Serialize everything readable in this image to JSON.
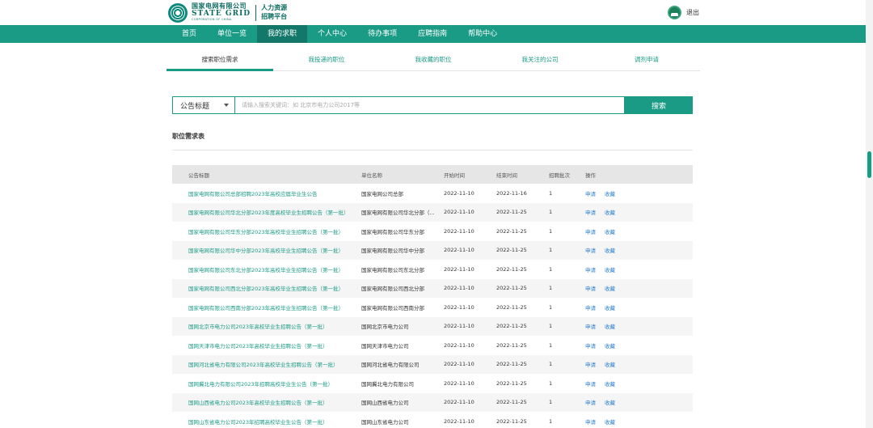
{
  "header": {
    "logo_cn": "国家电网有限公司",
    "logo_en": "STATE GRID",
    "logo_en_sub": "CORPORATION OF CHINA",
    "platform_line1": "人力资源",
    "platform_line2": "招聘平台",
    "logout": "退出"
  },
  "nav": {
    "items": [
      {
        "label": "首页"
      },
      {
        "label": "单位一览"
      },
      {
        "label": "我的求职"
      },
      {
        "label": "个人中心"
      },
      {
        "label": "待办事项"
      },
      {
        "label": "应聘指南"
      },
      {
        "label": "帮助中心"
      }
    ],
    "active_index": 2
  },
  "subtabs": {
    "items": [
      {
        "label": "搜索职位需求"
      },
      {
        "label": "我投递的职位"
      },
      {
        "label": "我收藏的职位"
      },
      {
        "label": "我关注的公司"
      },
      {
        "label": "调剂申请"
      }
    ],
    "active_index": 0
  },
  "search": {
    "select_value": "公告标题",
    "placeholder": "请输入搜索关键词：如 北京市电力公司2017等",
    "button": "搜索"
  },
  "section": {
    "title": "职位需求表"
  },
  "table": {
    "headers": [
      "公告标题",
      "单位名称",
      "开始时间",
      "结束时间",
      "招聘批次",
      "操作"
    ],
    "actions": {
      "apply": "申请",
      "collect": "收藏"
    },
    "rows": [
      [
        "国家电网有限公司总部招聘2023年高校应届毕业生公告",
        "国家电网公司总部",
        "2022-11-10",
        "2022-11-16",
        "1"
      ],
      [
        "国家电网有限公司华北分部2023年度高校毕业生招聘公告（第一批）",
        "国家电网有限公司华北分部（...",
        "2022-11-10",
        "2022-11-25",
        "1"
      ],
      [
        "国家电网有限公司华东分部2023年高校毕业生招聘公告（第一批）",
        "国家电网有限公司华东分部",
        "2022-11-10",
        "2022-11-25",
        "1"
      ],
      [
        "国家电网有限公司华中分部2023年高校毕业生招聘公告（第一批）",
        "国家电网有限公司华中分部",
        "2022-11-10",
        "2022-11-25",
        "1"
      ],
      [
        "国家电网有限公司东北分部2023年高校毕业生招聘公告（第一批）",
        "国家电网有限公司东北分部",
        "2022-11-10",
        "2022-11-25",
        "1"
      ],
      [
        "国家电网有限公司西北分部2023年高校毕业生招聘公告（第一批）",
        "国家电网有限公司西北分部",
        "2022-11-10",
        "2022-11-25",
        "1"
      ],
      [
        "国家电网有限公司西南分部2023年高校毕业生招聘公告（第一批）",
        "国家电网有限公司西南分部",
        "2022-11-10",
        "2022-11-25",
        "1"
      ],
      [
        "国网北京市电力公司2023年高校毕业生招聘公告（第一批）",
        "国网北京市电力公司",
        "2022-11-10",
        "2022-11-25",
        "1"
      ],
      [
        "国网天津市电力公司2023年高校毕业生招聘公告（第一批）",
        "国网天津市电力公司",
        "2022-11-10",
        "2022-11-25",
        "1"
      ],
      [
        "国网河北省电力有限公司2023年高校毕业生招聘公告（第一批）",
        "国网河北省电力有限公司",
        "2022-11-10",
        "2022-11-25",
        "1"
      ],
      [
        "国网冀北电力有限公司2023年招聘高校毕业生公告（第一批）",
        "国网冀北电力有限公司",
        "2022-11-10",
        "2022-11-25",
        "1"
      ],
      [
        "国网山西省电力公司2023年高校毕业生招聘公告（第一批）",
        "国网山西省电力公司",
        "2022-11-10",
        "2022-11-25",
        "1"
      ],
      [
        "国网山东省电力公司2023年招聘高校毕业生公告（第一批）",
        "国网山东省电力公司",
        "2022-11-10",
        "2022-11-25",
        "1"
      ]
    ]
  },
  "colors": {
    "brand": "#1a9b86",
    "brand_dark": "#13786a",
    "action_link": "#2b7fd0"
  }
}
